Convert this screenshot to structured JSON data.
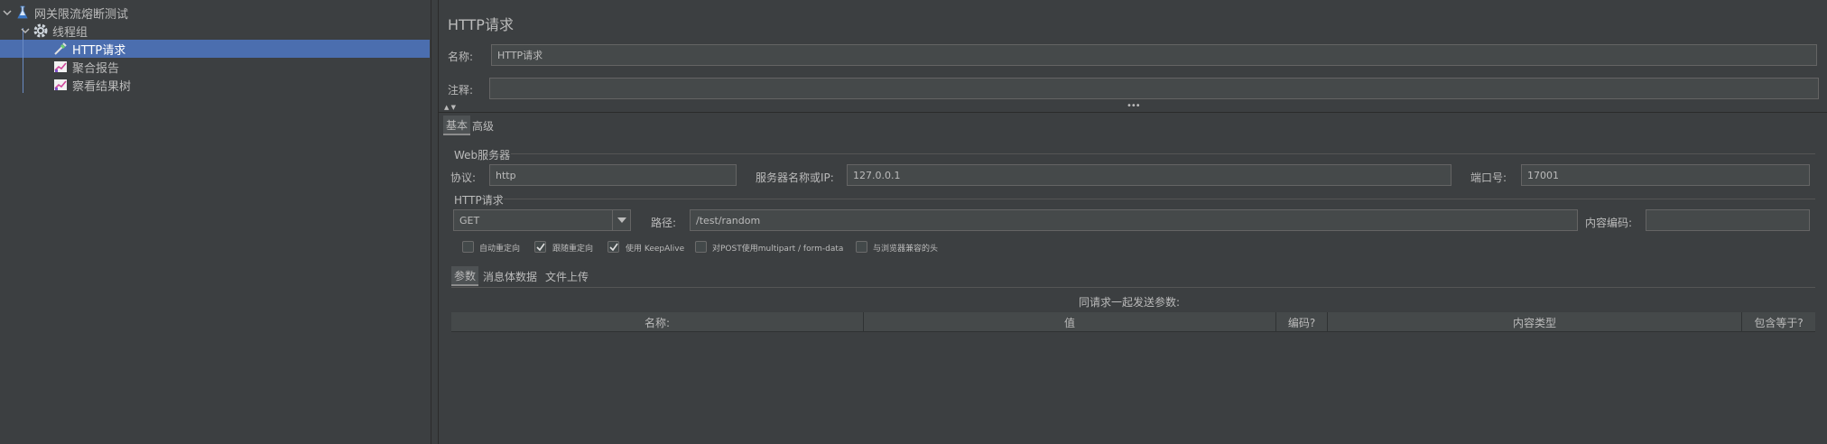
{
  "tree": {
    "items": [
      {
        "label": "网关限流熔断测试",
        "icon": "flask-icon"
      },
      {
        "label": "线程组",
        "icon": "gear-icon"
      },
      {
        "label": "HTTP请求",
        "icon": "pipette-icon"
      },
      {
        "label": "聚合报告",
        "icon": "chart-icon"
      },
      {
        "label": "察看结果树",
        "icon": "chart-icon"
      }
    ]
  },
  "panel": {
    "title": "HTTP请求",
    "name_label": "名称:",
    "name_value": "HTTP请求",
    "comment_label": "注释:",
    "comment_value": ""
  },
  "tabs": {
    "basic": "基本",
    "advanced": "高级"
  },
  "web_server": {
    "group_title": "Web服务器",
    "protocol_label": "协议:",
    "protocol_value": "http",
    "server_label": "服务器名称或IP:",
    "server_value": "127.0.0.1",
    "port_label": "端口号:",
    "port_value": "17001"
  },
  "http_request": {
    "group_title": "HTTP请求",
    "method": "GET",
    "path_label": "路径:",
    "path_value": "/test/random",
    "encoding_label": "内容编码:",
    "encoding_value": ""
  },
  "options": [
    {
      "label": "自动重定向",
      "checked": false
    },
    {
      "label": "跟随重定向",
      "checked": true
    },
    {
      "label": "使用 KeepAlive",
      "checked": true
    },
    {
      "label": "对POST使用multipart / form-data",
      "checked": false
    },
    {
      "label": "与浏览器兼容的头",
      "checked": false
    }
  ],
  "sub_tabs": {
    "params": "参数",
    "body": "消息体数据",
    "files": "文件上传"
  },
  "params_table": {
    "caption": "同请求一起发送参数:",
    "headers": [
      "名称:",
      "值",
      "编码?",
      "内容类型",
      "包含等于?"
    ]
  },
  "colors": {
    "background": "#3c3f41",
    "selection": "#4b6eaf",
    "field_bg": "#45494a"
  }
}
